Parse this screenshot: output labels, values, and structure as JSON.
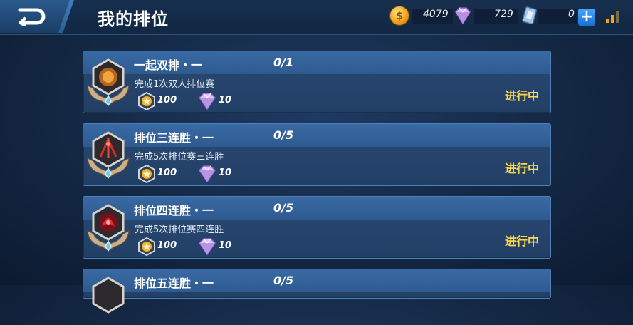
{
  "header": {
    "title": "我的排位",
    "gold": "4079",
    "diamonds": "729",
    "cards": "0",
    "plus": "+"
  },
  "tasks": [
    {
      "title": "一起双排・一",
      "progress": "0/1",
      "description": "完成1次双人排位赛",
      "reward_coin": "100",
      "reward_gem": "10",
      "status": "进行中",
      "badge": "amber"
    },
    {
      "title": "排位三连胜・一",
      "progress": "0/5",
      "description": "完成5次排位赛三连胜",
      "reward_coin": "100",
      "reward_gem": "10",
      "status": "进行中",
      "badge": "red-swords"
    },
    {
      "title": "排位四连胜・一",
      "progress": "0/5",
      "description": "完成5次排位赛四连胜",
      "reward_coin": "100",
      "reward_gem": "10",
      "status": "进行中",
      "badge": "crimson"
    },
    {
      "title": "排位五连胜・一",
      "progress": "0/5",
      "description": "",
      "reward_coin": "",
      "reward_gem": "",
      "status": "",
      "badge": "amber"
    }
  ],
  "colors": {
    "accent": "#ffd84a",
    "header_blue": "#3a6aa4",
    "background": "#142844"
  }
}
